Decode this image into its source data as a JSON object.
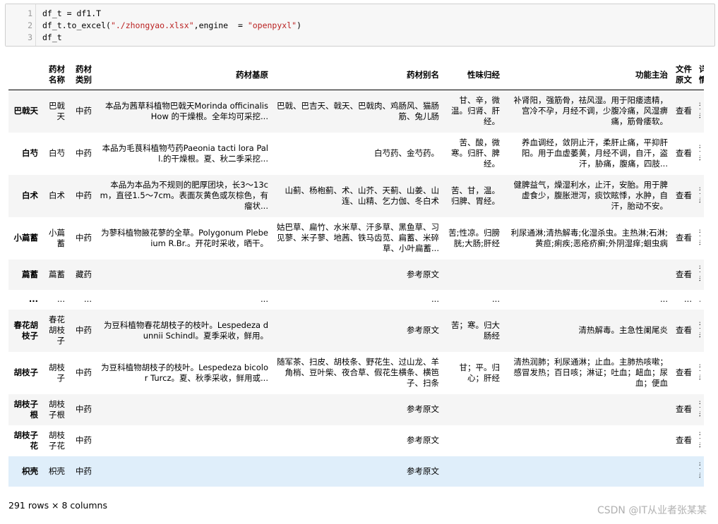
{
  "code": {
    "line_numbers": [
      "1",
      "2",
      "3"
    ],
    "line1": "df_t = df1.T",
    "line2_prefix": "df_t.to_excel(",
    "line2_str1": "\"./zhongyao.xlsx\"",
    "line2_mid": ",engine  = ",
    "line2_str2": "\"openpyxl\"",
    "line2_suffix": ")",
    "line3": "df_t"
  },
  "table": {
    "headers": [
      "",
      "药材名称",
      "药材类别",
      "药材基原",
      "药材别名",
      "性味归经",
      "功能主治",
      "文件原文",
      "详情"
    ],
    "rows": [
      {
        "index": "巴戟天",
        "cells": [
          "巴戟天",
          "中药",
          "本品为茜草科植物巴戟天Morinda officinalis How 的干燥根。全年均可采挖...",
          "巴戟、巴吉天、戟天、巴戟肉、鸡肠风、猫肠筋、兔儿肠",
          "甘、辛，微温。归肾、肝经。",
          "补肾阳，强筋骨，祛风湿。用于阳痿遗精，宫冷不孕，月经不调，少腹冷痛，风湿痹痛，筋骨痿软。",
          "查看",
          "查看"
        ]
      },
      {
        "index": "白芍",
        "cells": [
          "白芍",
          "中药",
          "本品为毛茛科植物芍药Paeonia tacti lora Pall.的干燥根。夏、秋二季采挖...",
          "白芍药、金芍药。",
          "苦、酸，微寒。归肝、脾经。",
          "养血调经，敛阴止汗，柔肝止痛，平抑肝阳。用于血虚萎黄，月经不调，自汗，盗汗，胁痛，腹痛，四肢...",
          "查看",
          "查看"
        ]
      },
      {
        "index": "白术",
        "cells": [
          "白术",
          "中药",
          "本品为本品为不规则的肥厚团块，长3～13cm，直径1.5～7cm。表面灰黄色或灰棕色，有瘤状...",
          "山蓟、杨枹蓟、术、山芥、天蓟、山姜、山连、山精、乞力伽、冬白术",
          "苦、甘，温。归脾、胃经。",
          "健脾益气，燥湿利水，止汗，安胎。用于脾虚食少，腹胀泄泻，痰饮眩悸，水肿，自汗，胎动不安。",
          "查看",
          "查看"
        ]
      },
      {
        "index": "小萹蓄",
        "cells": [
          "小萹蓄",
          "中药",
          "为蓼科植物腋花蓼的全草。Polygonum Plebeium R.Br.。开花时采收，晒干。",
          "姑巴草、扁竹、水米草、汗多草、黑鱼草、习见蓼、米子蓼、地茜、铁马齿苋、扁蓄、米碎草、小叶扁蓄...",
          "苦;性凉。归膀胱;大肠;肝经",
          "利尿通淋;清热解毒;化湿杀虫。主热淋;石淋;黄疸;痢疾;恶疮疥癣;外阴湿痒;蛔虫病",
          "查看",
          "查看"
        ]
      },
      {
        "index": "萹蓄",
        "cells": [
          "萹蓄",
          "藏药",
          "",
          "参考原文",
          "",
          "",
          "查看",
          "查看"
        ]
      },
      {
        "index": "...",
        "cells": [
          "...",
          "...",
          "...",
          "...",
          "...",
          "...",
          "...",
          "..."
        ]
      },
      {
        "index": "春花胡枝子",
        "cells": [
          "春花胡枝子",
          "中药",
          "为豆科植物春花胡枝子的枝叶。Lespedeza dunnii Schindl。夏季采收，鲜用。",
          "参考原文",
          "苦；寒。归大肠经",
          "清热解毒。主急性阑尾炎",
          "查看",
          "查看"
        ]
      },
      {
        "index": "胡枝子",
        "cells": [
          "胡枝子",
          "中药",
          "为豆科植物胡枝子的枝叶。Lespedeza bicolor Turcz。夏、秋季采收，鲜用或...",
          "随军茶、扫皮、胡枝条、野花生、过山龙、羊角梢、豆叶柴、夜合草、假花生横条、横笆子、扫条",
          "甘；平。归心；肝经",
          "清热润肺；利尿通淋；止血。主肺热咳嗽；感冒发热；百日咳；淋证；吐血；衄血；尿血；便血",
          "查看",
          "查看"
        ]
      },
      {
        "index": "胡枝子根",
        "cells": [
          "胡枝子根",
          "中药",
          "",
          "参考原文",
          "",
          "",
          "查看",
          "查看"
        ]
      },
      {
        "index": "胡枝子花",
        "cells": [
          "胡枝子花",
          "中药",
          "",
          "参考原文",
          "",
          "",
          "查看",
          "查看"
        ]
      },
      {
        "index": "枳壳",
        "cells": [
          "枳壳",
          "中药",
          "",
          "参考原文",
          "",
          "",
          "",
          "查看"
        ]
      }
    ]
  },
  "footer": {
    "shape": "291 rows × 8 columns",
    "watermark": "CSDN @IT从业者张某某"
  }
}
